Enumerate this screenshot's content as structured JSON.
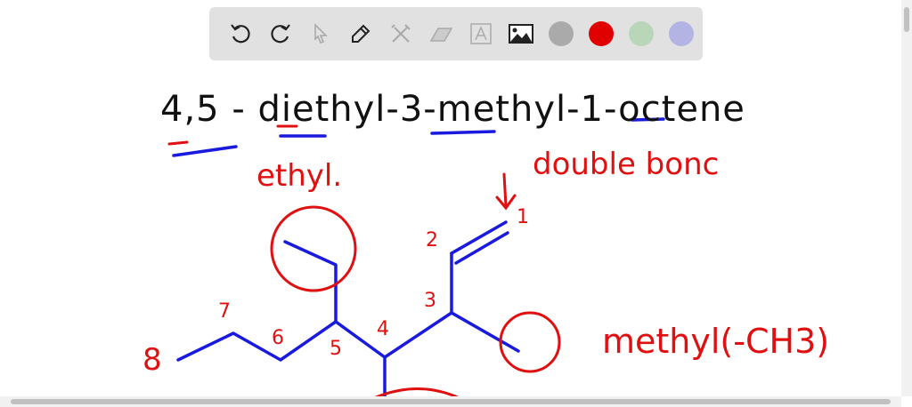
{
  "toolbar": {
    "tools": [
      "undo-icon",
      "redo-icon",
      "select-icon",
      "pen-icon",
      "tools-icon",
      "eraser-icon",
      "text-icon",
      "image-icon"
    ],
    "colors": [
      "#aaaaaa",
      "#e00000",
      "#b9d6b9",
      "#b4b4e4"
    ]
  },
  "board": {
    "title": "4,5 - diethyl-3-methyl-1-octene",
    "ethyl_label": "ethyl.",
    "double_bond_label": "double bonc",
    "methyl_label": "methyl(-CH3)",
    "carbon_numbers": [
      "1",
      "2",
      "3",
      "4",
      "5",
      "6",
      "7",
      "8"
    ],
    "ink_blue": "#1a1adf",
    "ink_red": "#e01010",
    "ink_black": "#111111"
  }
}
